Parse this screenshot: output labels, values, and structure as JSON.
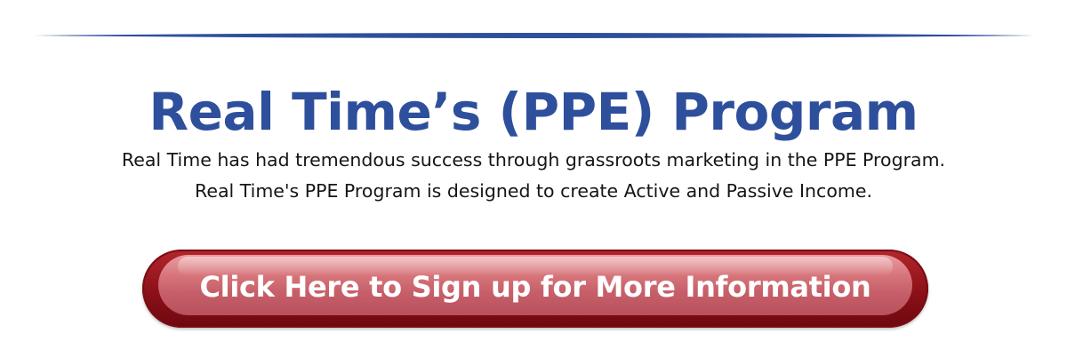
{
  "banner": {
    "title": "Real Time’s (PPE) Program",
    "description_line_1": "Real Time has had tremendous success through grassroots marketing in the PPE Program.",
    "description_line_2": "Real Time's PPE Program is designed to create Active and Passive Income.",
    "cta_label": "Click Here to Sign up for More Information"
  },
  "colors": {
    "title": "#2e4f9c",
    "divider": "#2e4f9c",
    "button": "#9e1a22",
    "button_text": "#ffffff",
    "body_text": "#151515"
  }
}
